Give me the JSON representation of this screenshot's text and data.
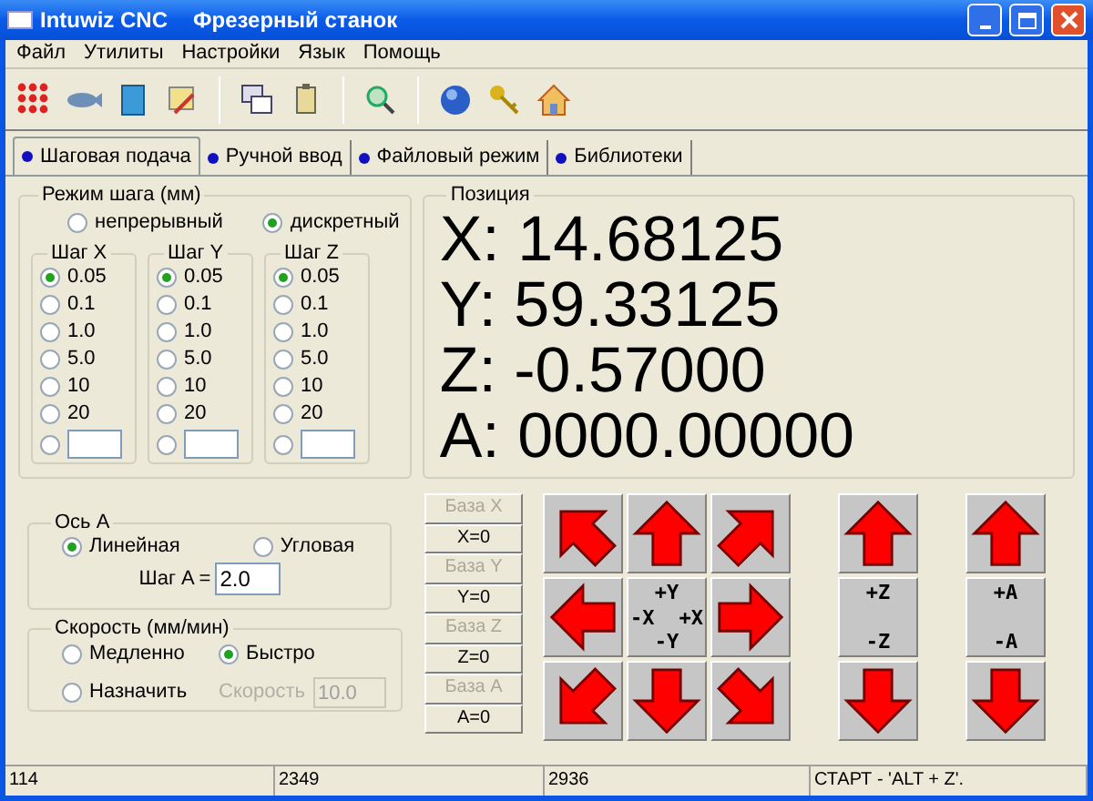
{
  "window": {
    "title": "Intuwiz CNC",
    "subtitle": "Фрезерный станок"
  },
  "menu": [
    "Файл",
    "Утилиты",
    "Настройки",
    "Язык",
    "Помощь"
  ],
  "tabs": [
    {
      "label": "Шаговая подача",
      "selected": true
    },
    {
      "label": "Ручной ввод",
      "selected": false
    },
    {
      "label": "Файловый режим",
      "selected": false
    },
    {
      "label": "Библиотеки",
      "selected": false
    }
  ],
  "step_mode": {
    "title": "Режим шага (мм)",
    "options": [
      {
        "label": "непрерывный",
        "selected": false
      },
      {
        "label": "дискретный",
        "selected": true
      }
    ],
    "axes": [
      {
        "title": "Шаг X",
        "options": [
          {
            "label": "0.05",
            "selected": true
          },
          {
            "label": "0.1",
            "selected": false
          },
          {
            "label": "1.0",
            "selected": false
          },
          {
            "label": "5.0",
            "selected": false
          },
          {
            "label": "10",
            "selected": false
          },
          {
            "label": "20",
            "selected": false
          },
          {
            "kind": "custom",
            "selected": false
          }
        ]
      },
      {
        "title": "Шаг Y",
        "options": [
          {
            "label": "0.05",
            "selected": true
          },
          {
            "label": "0.1",
            "selected": false
          },
          {
            "label": "1.0",
            "selected": false
          },
          {
            "label": "5.0",
            "selected": false
          },
          {
            "label": "10",
            "selected": false
          },
          {
            "label": "20",
            "selected": false
          },
          {
            "kind": "custom",
            "selected": false
          }
        ]
      },
      {
        "title": "Шаг Z",
        "options": [
          {
            "label": "0.05",
            "selected": true
          },
          {
            "label": "0.1",
            "selected": false
          },
          {
            "label": "1.0",
            "selected": false
          },
          {
            "label": "5.0",
            "selected": false
          },
          {
            "label": "10",
            "selected": false
          },
          {
            "label": "20",
            "selected": false
          },
          {
            "kind": "custom",
            "selected": false
          }
        ]
      }
    ]
  },
  "position": {
    "title": "Позиция",
    "lines": [
      "X: 14.68125",
      "Y: 59.33125",
      "Z: -0.57000",
      "A: 0000.00000"
    ]
  },
  "axis_a": {
    "title": "Ось A",
    "options": [
      {
        "label": "Линейная",
        "selected": true
      },
      {
        "label": "Угловая",
        "selected": false
      }
    ],
    "step_label": "Шаг A =",
    "step_value": "2.0"
  },
  "speed": {
    "title": "Скорость (мм/мин)",
    "options": [
      {
        "label": "Медленно",
        "selected": false
      },
      {
        "label": "Быстро",
        "selected": true
      },
      {
        "label": "Назначить",
        "selected": false
      }
    ],
    "field_label": "Скорость",
    "field_value": "10.0",
    "field_disabled": true
  },
  "base_buttons": [
    {
      "label": "База X",
      "disabled": true
    },
    {
      "label": "X=0",
      "disabled": false
    },
    {
      "label": "База Y",
      "disabled": true
    },
    {
      "label": "Y=0",
      "disabled": false
    },
    {
      "label": "База Z",
      "disabled": true
    },
    {
      "label": "Z=0",
      "disabled": false
    },
    {
      "label": "База A",
      "disabled": true
    },
    {
      "label": "A=0",
      "disabled": false
    }
  ],
  "jog_center": {
    "plus_y": "+Y",
    "minus_x": "-X",
    "plus_x": "+X",
    "minus_y": "-Y"
  },
  "z_labels": [
    "+Z",
    "-Z"
  ],
  "a_labels": [
    "+A",
    "-A"
  ],
  "status_bar": [
    "114",
    "2349",
    "2936",
    "СТАРТ - 'ALT + Z'."
  ]
}
